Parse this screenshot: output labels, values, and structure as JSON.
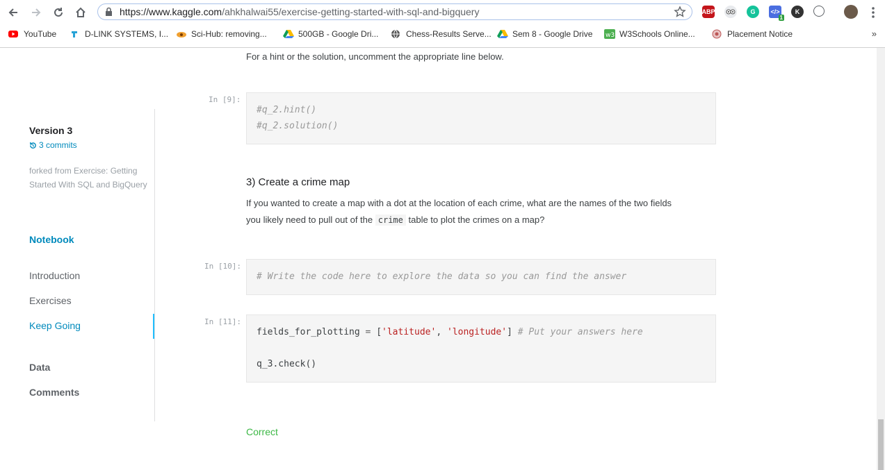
{
  "browser": {
    "url_host": "https://www.kaggle.com",
    "url_path": "/ahkhalwai55/exercise-getting-started-with-sql-and-bigquery",
    "extensions": [
      "ABP",
      "1"
    ],
    "bookmarks": [
      {
        "label": "YouTube",
        "icon": "youtube-icon",
        "color": "#ff0000"
      },
      {
        "label": "D-LINK SYSTEMS, I...",
        "icon": "tplink-icon",
        "color": "#27a3d6"
      },
      {
        "label": "Sci-Hub: removing...",
        "icon": "scihub-icon",
        "color": "#e07b00"
      },
      {
        "label": "500GB - Google Dri...",
        "icon": "drive-icon",
        "color": "#fbbc04"
      },
      {
        "label": "Chess-Results Serve...",
        "icon": "globe-icon",
        "color": "#555555"
      },
      {
        "label": "Sem 8 - Google Drive",
        "icon": "drive-icon",
        "color": "#fbbc04"
      },
      {
        "label": "W3Schools Online...",
        "icon": "w3schools-icon",
        "color": "#4caf50"
      },
      {
        "label": "Placement Notice",
        "icon": "seal-icon",
        "color": "#b55"
      }
    ],
    "more_label": "»"
  },
  "sidebar": {
    "version": "Version 3",
    "commits": "3 commits",
    "forked_from": "forked from Exercise: Getting Started With SQL and BigQuery",
    "notebook": "Notebook",
    "items": [
      "Introduction",
      "Exercises",
      "Keep Going"
    ],
    "data": "Data",
    "comments": "Comments"
  },
  "content": {
    "hint_text": "For a hint or the solution, uncomment the appropriate line below.",
    "cell9": {
      "prompt": "In [9]:",
      "line1": "#q_2.hint()",
      "line2": "#q_2.solution()"
    },
    "heading": "3) Create a crime map",
    "para_line1": "If you wanted to create a map with a dot at the location of each crime, what are the names of the two fields",
    "para_line2_a": "you likely need to pull out of the",
    "para_code": "crime",
    "para_line2_b": "table to plot the crimes on a map?",
    "cell10": {
      "prompt": "In [10]:",
      "line1": "# Write the code here to explore the data so you can find the answer"
    },
    "cell11": {
      "prompt": "In [11]:",
      "var": "fields_for_plotting",
      "eq": " = ",
      "lb": "[",
      "s1": "'latitude'",
      "comma": ", ",
      "s2": "'longitude'",
      "rb": "]",
      "comment": " # Put your answers here",
      "line2": "q_3.check()"
    },
    "result": "Correct"
  }
}
